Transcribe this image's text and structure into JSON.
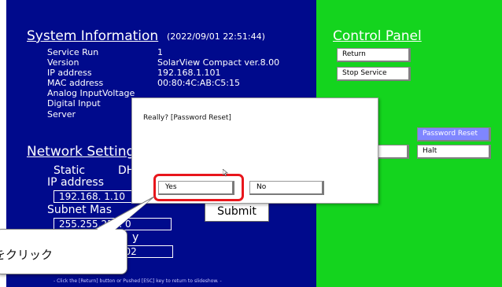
{
  "system": {
    "title": "System Information",
    "timestamp": "(2022/09/01 22:51:44)",
    "rows": [
      {
        "label": "Service Run",
        "value": "1"
      },
      {
        "label": "Version",
        "value": "SolarView Compact ver.8.00"
      },
      {
        "label": "IP address",
        "value": "192.168.1.101"
      },
      {
        "label": "MAC address",
        "value": "00:80:4C:AB:C5:15"
      },
      {
        "label": "Analog InputVoltage",
        "value": ""
      },
      {
        "label": "Digital Input",
        "value": ""
      },
      {
        "label": "Server",
        "value": ""
      }
    ]
  },
  "network": {
    "title": "Network Settings",
    "mode_static": "Static",
    "mode_dhcp": "DHC",
    "ip_label": "IP address",
    "ip_value": "192.168. 1.10",
    "subnet_label": "Subnet Mas",
    "subnet_value": "255.255.255. 0",
    "gateway_label": "y",
    "gateway_value": ".102",
    "submit_label": "Submit"
  },
  "footer_note": "- Click the [Return] button or Pushed [ESC] key to return to slideshow. -",
  "control_panel": {
    "title": "Control Panel",
    "return_label": "Return",
    "stop_service_label": "Stop Service",
    "password_reset_label": "Password Reset",
    "halt_label": "Halt"
  },
  "dialog": {
    "message": "Really? [Password Reset]",
    "yes_label": "Yes",
    "no_label": "No"
  },
  "callout": {
    "text": "をクリック"
  },
  "colors": {
    "left_panel": "#000a8c",
    "right_panel": "#14d41e",
    "highlight": "#e8161c",
    "selected_button": "#7f86ff"
  }
}
